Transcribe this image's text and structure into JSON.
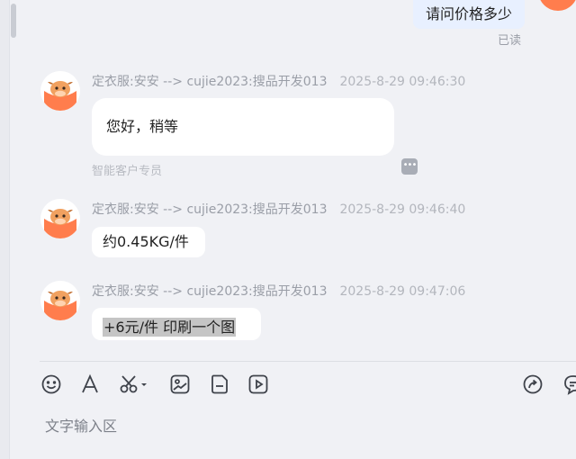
{
  "my_message": {
    "text": "请问价格多少",
    "status": "已读"
  },
  "messages": [
    {
      "sender": "定衣服:安安 --> cujie2023:搜品开发013",
      "time": "2025-8-29 09:46:30",
      "text": "您好，稍等",
      "agent_tag": "智能客户专员",
      "more_icon": "more-dots-icon"
    },
    {
      "sender": "定衣服:安安 --> cujie2023:搜品开发013",
      "time": "2025-8-29 09:46:40",
      "text": "约0.45KG/件"
    },
    {
      "sender": "定衣服:安安 --> cujie2023:搜品开发013",
      "time": "2025-8-29 09:47:06",
      "text": "+6元/件 印刷一个图"
    }
  ],
  "toolbar": {
    "icons": [
      "emoji-icon",
      "font-icon",
      "scissors-icon",
      "image-icon",
      "file-icon",
      "video-icon",
      "share-icon",
      "quick-reply-icon"
    ]
  },
  "input": {
    "placeholder": "文字输入区"
  },
  "colors": {
    "background": "#f0f1f5",
    "bubble": "#ffffff",
    "my_bubble": "#e8f0ff",
    "avatar": "#ff7d4d",
    "meta_text": "#9a9ea7"
  }
}
